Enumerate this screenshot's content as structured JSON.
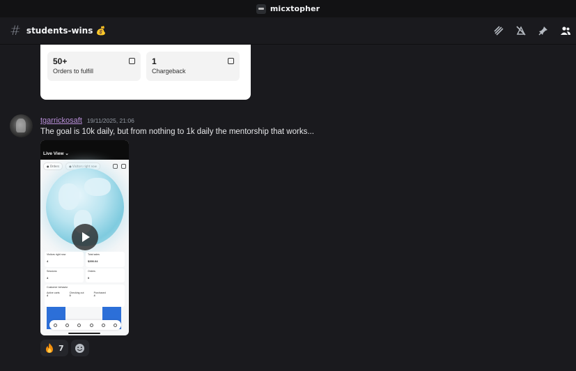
{
  "window": {
    "title": "micxtopher"
  },
  "header": {
    "hash": "#",
    "channel_name": "students-wins 💰"
  },
  "header_icons": [
    "threads-icon",
    "mute-icon",
    "pin-icon",
    "members-icon"
  ],
  "previous_attachment": {
    "stats": [
      {
        "value": "50+",
        "label": "Orders to fulfill",
        "icon": "inbox-icon"
      },
      {
        "value": "1",
        "label": "Chargeback",
        "icon": "clipboard-icon"
      }
    ]
  },
  "message": {
    "username": "tgarrickosaft",
    "timestamp": "19/11/2025, 21:06",
    "text": "The goal is 10k daily, but from nothing to 1k daily the mentorship that works..."
  },
  "video": {
    "live_view": "Live View ⌄",
    "pills": [
      "● Orders",
      "● Visitors right now"
    ],
    "cards": [
      {
        "label": "Visitors right now",
        "value": "4"
      },
      {
        "label": "Total sales",
        "value": "$390.04"
      },
      {
        "label": "Sessions",
        "value": "4"
      },
      {
        "label": "Orders",
        "value": "0"
      }
    ],
    "behavior_title": "Customer behavior",
    "behavior": [
      {
        "label": "Active carts",
        "value": "4"
      },
      {
        "label": "Checking out",
        "value": "0"
      },
      {
        "label": "Purchased",
        "value": "4"
      }
    ]
  },
  "reactions": [
    {
      "emoji": "fire-icon",
      "count": "7"
    }
  ],
  "colors": {
    "username": "#b98fd9",
    "background": "#1a1a1e",
    "chart_blue": "#2c6fd8"
  }
}
